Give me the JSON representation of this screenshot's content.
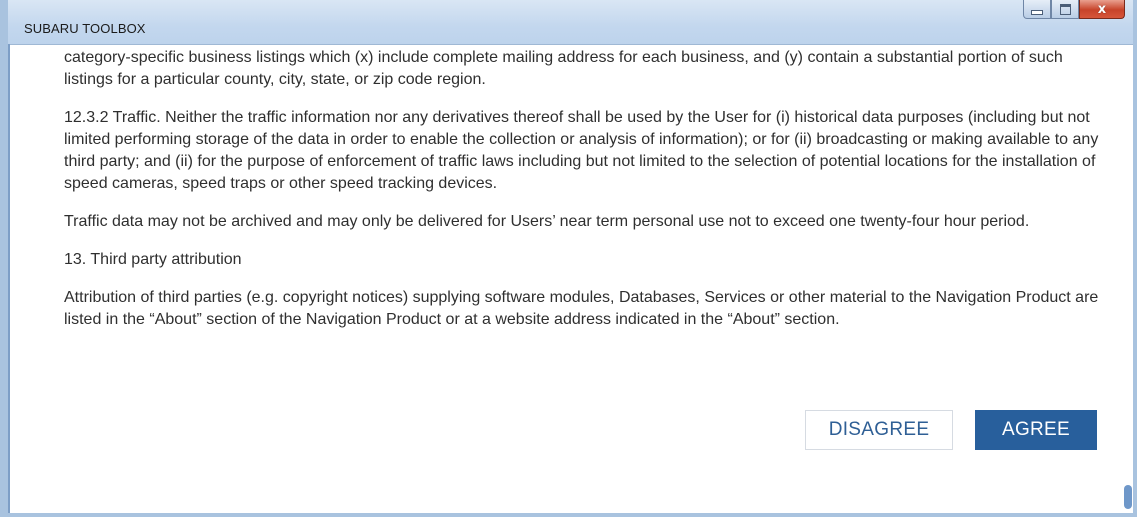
{
  "window": {
    "title": "SUBARU TOOLBOX",
    "controls": {
      "minimize_icon": "minimize-icon",
      "maximize_icon": "maximize-icon",
      "close_icon": "close-icon",
      "close_glyph": "x"
    }
  },
  "license": {
    "paragraphs": [
      "category-specific business listings which (x) include complete mailing address for each business, and (y) contain a substantial portion of such listings for a particular county, city, state, or zip code region.",
      "12.3.2 Traffic. Neither the traffic information nor any derivatives thereof shall be used by the User for (i) historical data purposes (including but not limited performing storage of the data in order to enable the collection or analysis of information); or for (ii) broadcasting or making available to any third party; and (ii) for the purpose of enforcement of traffic laws including but not limited to the selection of potential locations for the installation of speed cameras, speed traps or other speed tracking devices.",
      "Traffic data may not be archived and may only be delivered for Users’ near term personal use not to exceed one twenty-four hour period.",
      "13. Third party attribution",
      "Attribution of third parties (e.g. copyright notices) supplying software modules, Databases, Services or other material to the Navigation Product are listed in the “About” section of the Navigation Product or at a website address indicated in the “About” section."
    ]
  },
  "buttons": {
    "disagree_label": "DISAGREE",
    "agree_label": "AGREE"
  },
  "colors": {
    "accent": "#285f9c",
    "text": "#2f2f2f",
    "titlebar": "#c3d7ee"
  }
}
